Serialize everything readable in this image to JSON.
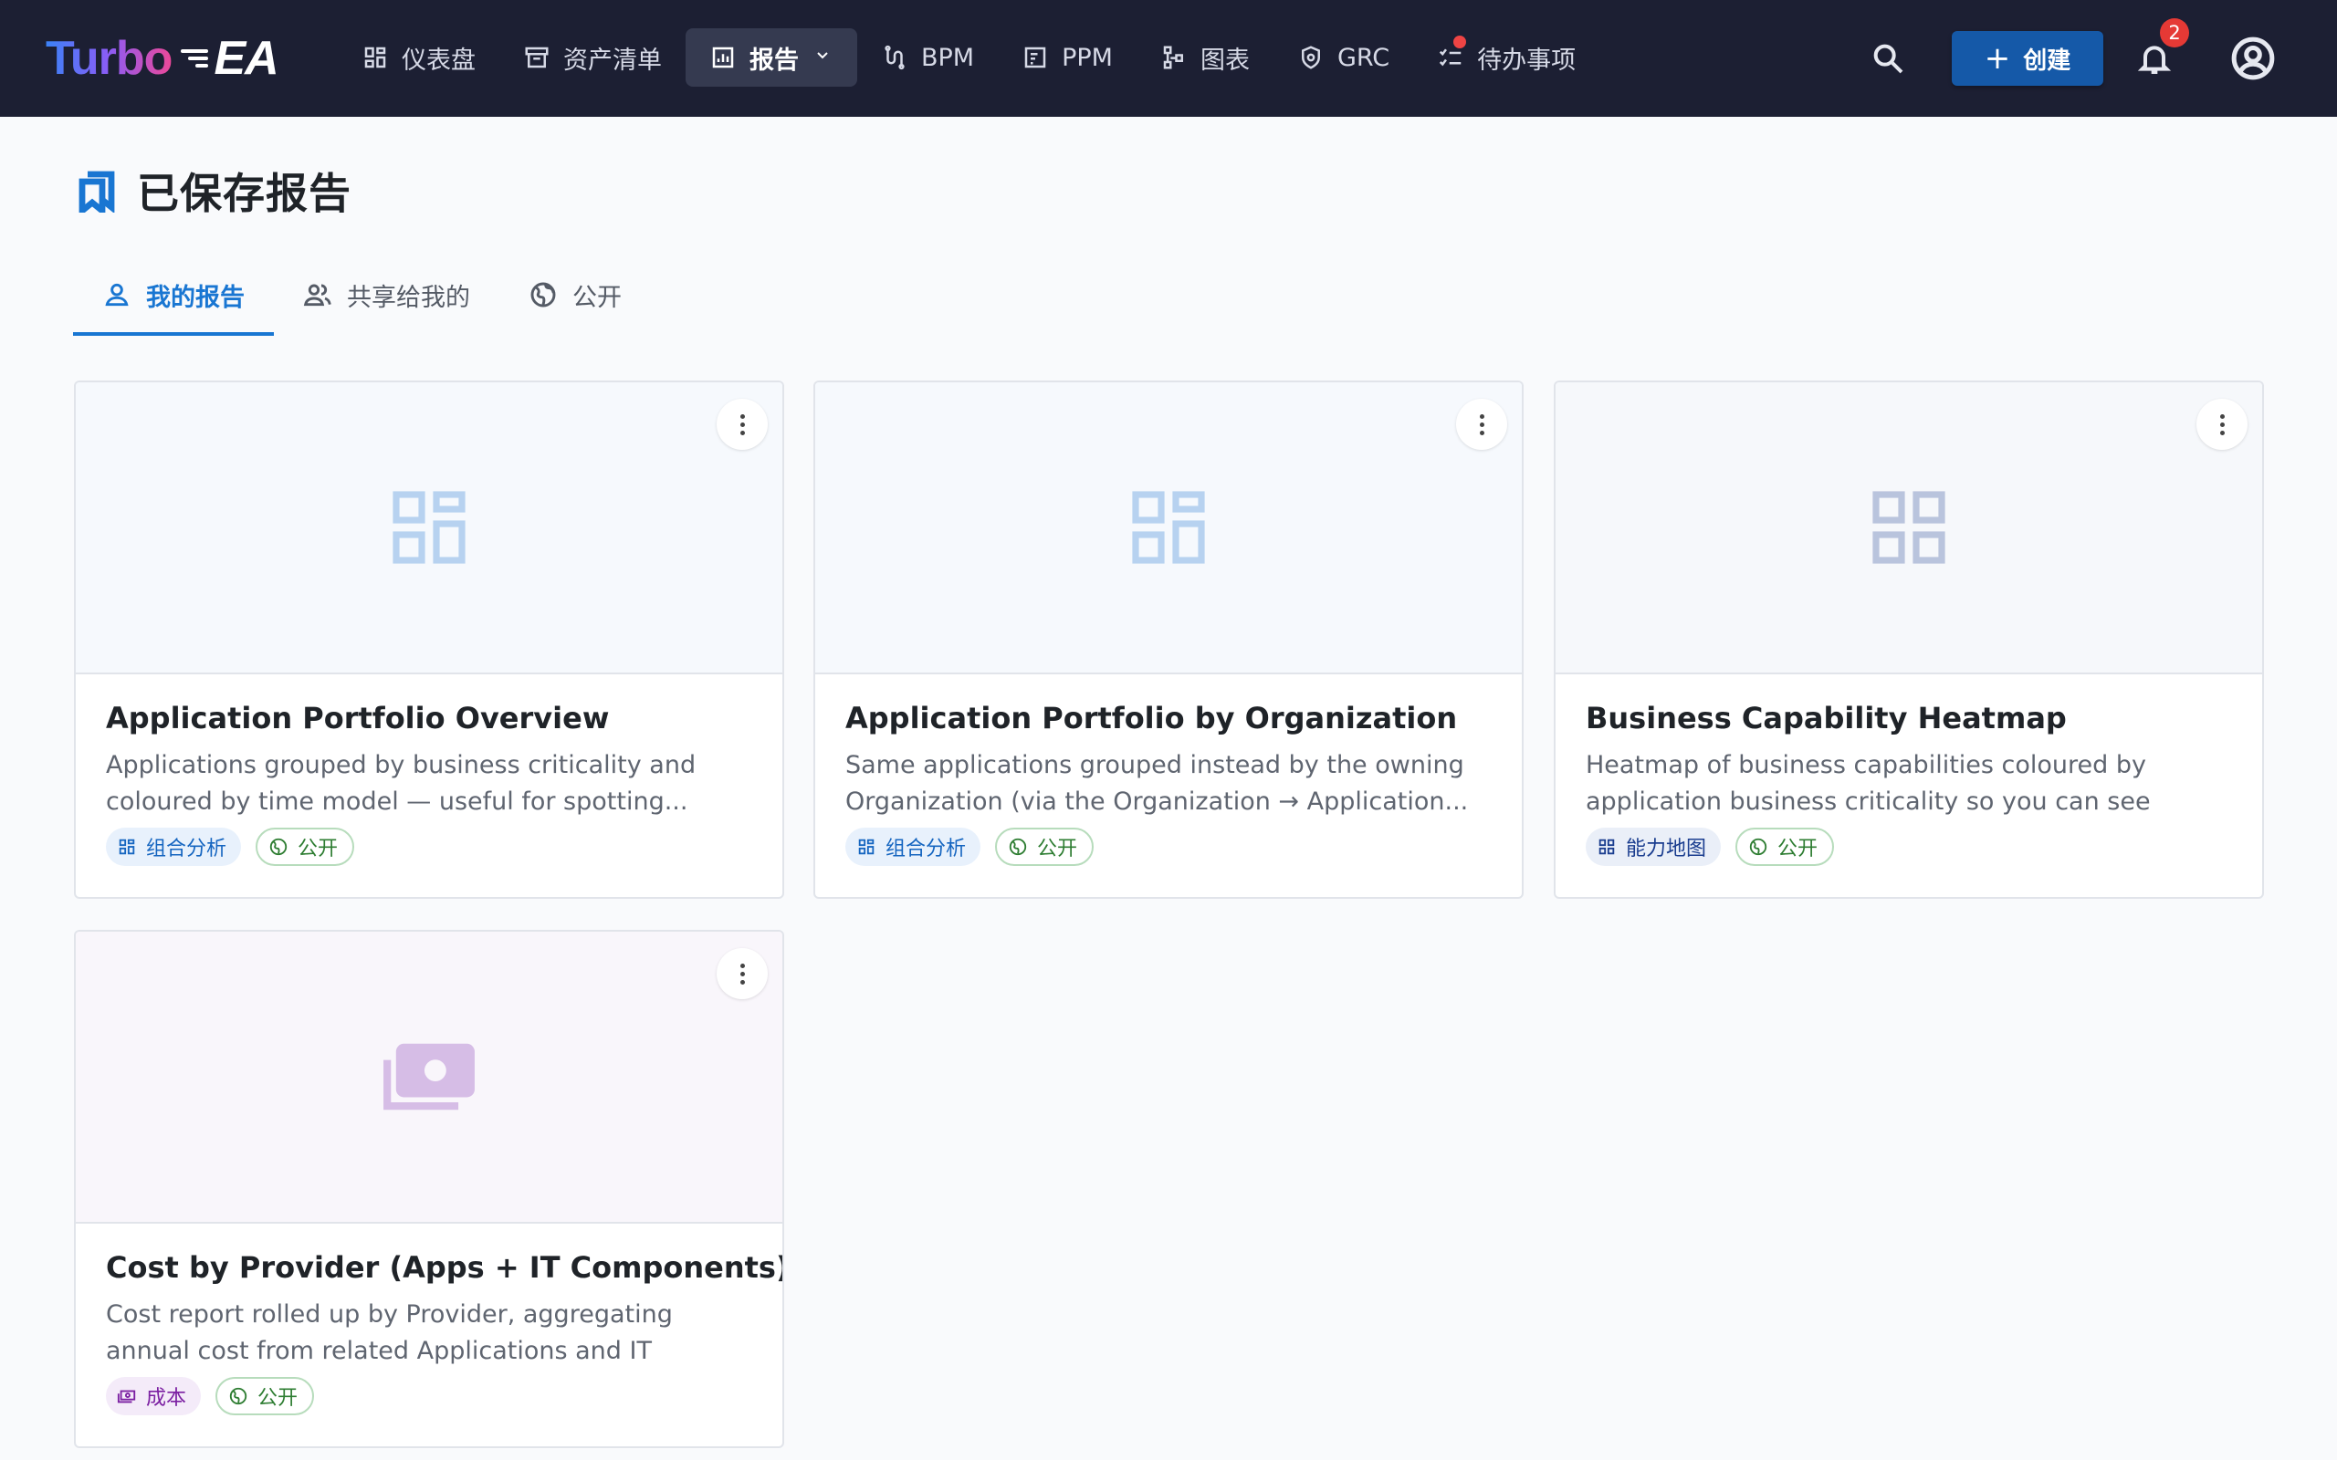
{
  "brand": {
    "part1": "Turbo",
    "part2": "EA"
  },
  "nav": {
    "items": [
      {
        "label": "仪表盘",
        "icon": "dashboard-icon"
      },
      {
        "label": "资产清单",
        "icon": "archive-icon"
      },
      {
        "label": "报告",
        "icon": "report-icon",
        "active": true,
        "has_dropdown": true
      },
      {
        "label": "BPM",
        "icon": "process-icon"
      },
      {
        "label": "PPM",
        "icon": "project-icon"
      },
      {
        "label": "图表",
        "icon": "diagram-icon"
      },
      {
        "label": "GRC",
        "icon": "shield-icon"
      },
      {
        "label": "待办事项",
        "icon": "todo-list-icon",
        "has_dot": true
      }
    ]
  },
  "toolbar": {
    "create_label": "创建",
    "notification_count": "2"
  },
  "page": {
    "title": "已保存报告"
  },
  "tabs": [
    {
      "label": "我的报告",
      "icon": "person-icon",
      "active": true
    },
    {
      "label": "共享给我的",
      "icon": "people-icon"
    },
    {
      "label": "公开",
      "icon": "globe-icon"
    }
  ],
  "cards": [
    {
      "title": "Application Portfolio Overview",
      "description": "Applications grouped by business criticality and coloured by time model — useful for spotting...",
      "type_label": "组合分析",
      "visibility_label": "公开"
    },
    {
      "title": "Application Portfolio by Organization",
      "description": "Same applications grouped instead by the owning Organization (via the Organization → Application...",
      "type_label": "组合分析",
      "visibility_label": "公开"
    },
    {
      "title": "Business Capability Heatmap",
      "description": "Heatmap of business capabilities coloured by application business criticality so you can see wher...",
      "type_label": "能力地图",
      "visibility_label": "公开"
    },
    {
      "title": "Cost by Provider (Apps + IT Components)",
      "description": "Cost report rolled up by Provider, aggregating annual cost from related Applications and IT Components ...",
      "type_label": "成本",
      "visibility_label": "公开"
    }
  ],
  "colors": {
    "topbar": "#1c1f33",
    "accent": "#1976d2",
    "create_button": "#1559a8",
    "public_chip": "#2e7d32",
    "cost_chip": "#7b1fa2"
  }
}
